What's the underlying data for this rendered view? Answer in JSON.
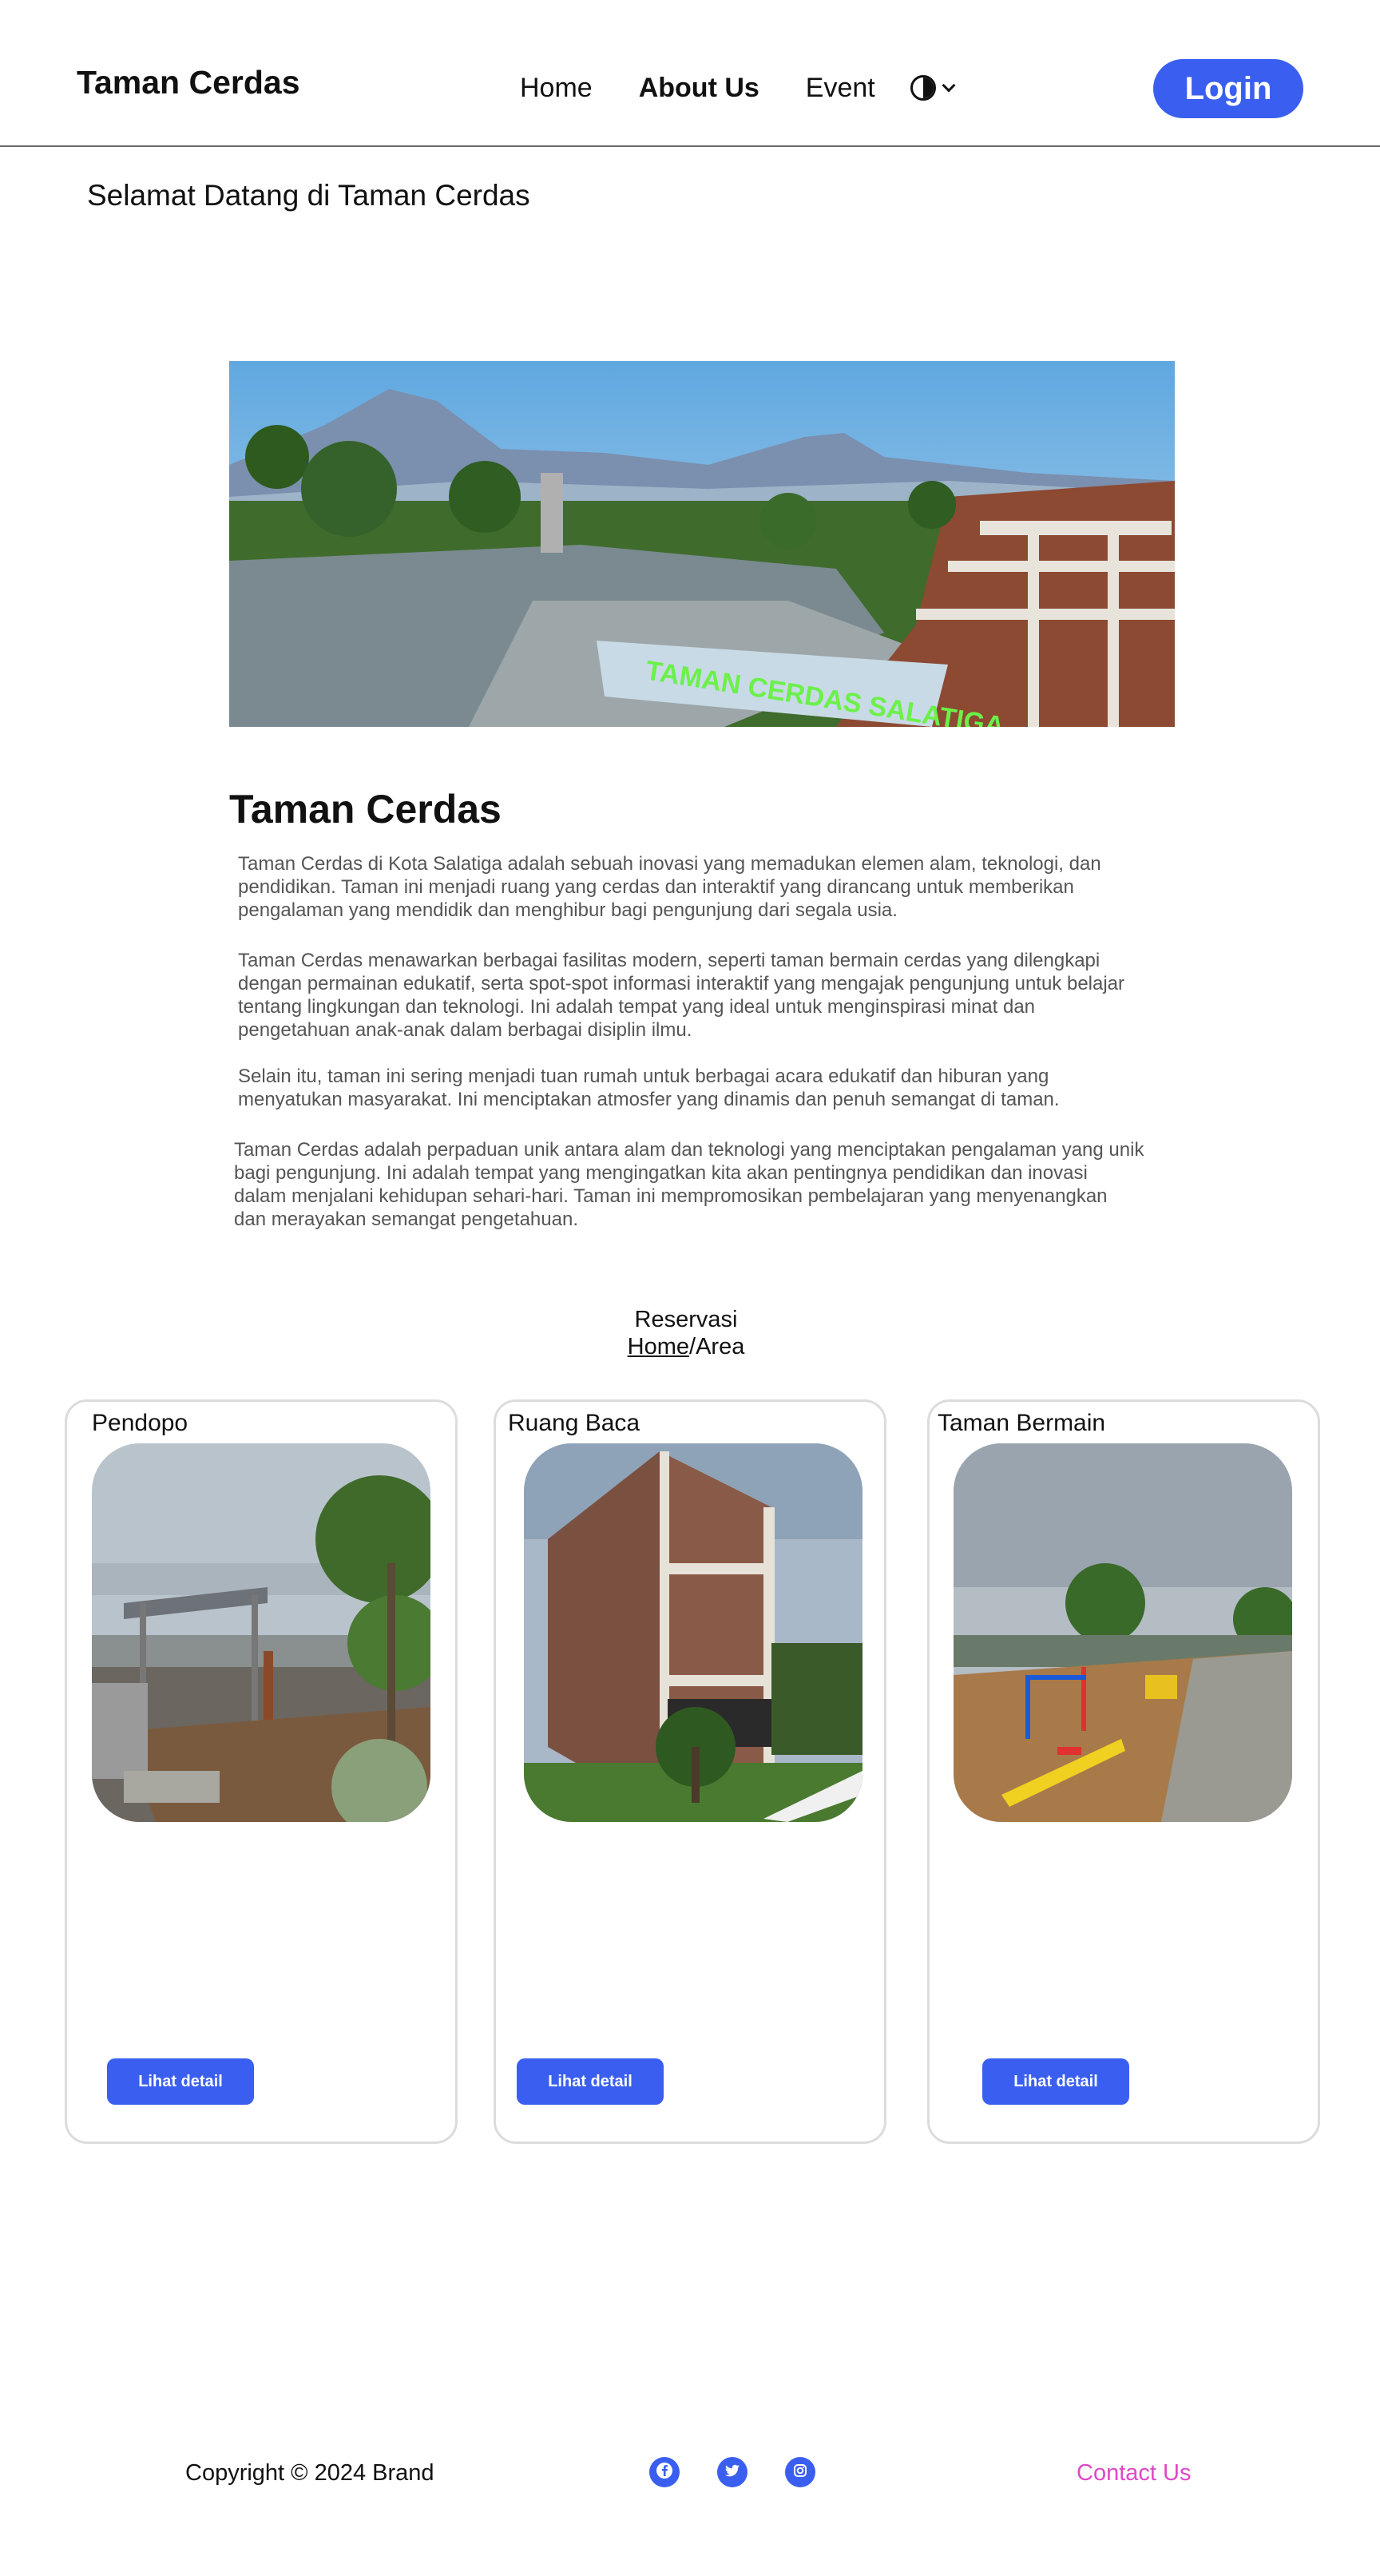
{
  "header": {
    "brand": "Taman Cerdas",
    "nav": [
      {
        "label": "Home"
      },
      {
        "label": "About Us"
      },
      {
        "label": "Event"
      }
    ],
    "theme_icon": "contrast-icon",
    "login_label": "Login"
  },
  "welcome": "Selamat Datang di Taman Cerdas",
  "hero": {
    "sign_text": "TAMAN CERDAS SALATIGA"
  },
  "about": {
    "title": "Taman Cerdas",
    "paragraphs": [
      "Taman Cerdas di Kota Salatiga adalah sebuah inovasi yang memadukan elemen alam, teknologi, dan pendidikan. Taman ini menjadi ruang yang cerdas dan interaktif yang dirancang untuk memberikan pengalaman yang mendidik dan menghibur bagi pengunjung dari segala usia.",
      "Taman Cerdas menawarkan berbagai fasilitas modern, seperti taman bermain cerdas yang dilengkapi dengan permainan edukatif, serta spot-spot informasi interaktif yang mengajak pengunjung untuk belajar tentang lingkungan dan teknologi. Ini adalah tempat yang ideal untuk menginspirasi minat dan pengetahuan anak-anak dalam berbagai disiplin ilmu.",
      "Selain itu, taman ini sering menjadi tuan rumah untuk berbagai acara edukatif dan hiburan yang menyatukan masyarakat. Ini menciptakan atmosfer yang dinamis dan penuh semangat di taman.",
      "Taman Cerdas adalah perpaduan unik antara alam dan teknologi yang menciptakan pengalaman yang unik bagi pengunjung. Ini adalah tempat yang mengingatkan kita akan pentingnya pendidikan dan inovasi dalam menjalani kehidupan sehari-hari. Taman ini mempromosikan pembelajaran yang menyenangkan dan merayakan semangat pengetahuan."
    ]
  },
  "reservasi": {
    "title": "Reservasi",
    "crumb_home": "Home",
    "crumb_sep": "/",
    "crumb_current": "Area"
  },
  "areas": [
    {
      "title": "Pendopo",
      "button": "Lihat detail"
    },
    {
      "title": "Ruang Baca",
      "button": "Lihat detail"
    },
    {
      "title": "Taman Bermain",
      "button": "Lihat detail"
    }
  ],
  "footer": {
    "copyright": "Copyright © 2024 Brand",
    "social": [
      "facebook-icon",
      "twitter-icon",
      "instagram-icon"
    ],
    "contact": "Contact Us"
  },
  "colors": {
    "accent": "#3a5ff0",
    "contact_link": "#e048c8",
    "sign_text": "#6cf04a"
  }
}
